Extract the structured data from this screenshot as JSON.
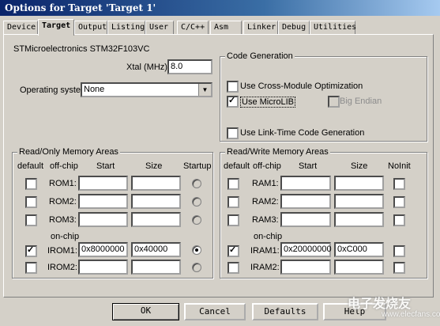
{
  "window": {
    "title": "Options for Target 'Target 1'"
  },
  "tabs": [
    "Device",
    "Target",
    "Output",
    "Listing",
    "User",
    "C/C++",
    "Asm",
    "Linker",
    "Debug",
    "Utilities"
  ],
  "device_name": "STMicroelectronics STM32F103VC",
  "xtal": {
    "label": "Xtal (MHz):",
    "value": "8.0"
  },
  "os": {
    "label": "Operating system:",
    "value": "None"
  },
  "code_generation": {
    "title": "Code Generation",
    "cross_module": {
      "label": "Use Cross-Module Optimization",
      "checked": false
    },
    "microlib": {
      "label": "Use MicroLIB",
      "checked": true
    },
    "big_endian": {
      "label": "Big Endian",
      "checked": false,
      "enabled": false
    },
    "link_time": {
      "label": "Use Link-Time Code Generation",
      "checked": false
    }
  },
  "rom_areas": {
    "title": "Read/Only Memory Areas",
    "headers": {
      "default": "default",
      "offchip": "off-chip",
      "start": "Start",
      "size": "Size",
      "startup": "Startup"
    },
    "onchip_label": "on-chip",
    "rows": [
      {
        "name": "ROM1:",
        "start": "",
        "size": "",
        "default": false,
        "startup": false
      },
      {
        "name": "ROM2:",
        "start": "",
        "size": "",
        "default": false,
        "startup": false
      },
      {
        "name": "ROM3:",
        "start": "",
        "size": "",
        "default": false,
        "startup": false
      },
      {
        "name": "IROM1:",
        "start": "0x8000000",
        "size": "0x40000",
        "default": true,
        "startup": true
      },
      {
        "name": "IROM2:",
        "start": "",
        "size": "",
        "default": false,
        "startup": false
      }
    ]
  },
  "ram_areas": {
    "title": "Read/Write Memory Areas",
    "headers": {
      "default": "default",
      "offchip": "off-chip",
      "start": "Start",
      "size": "Size",
      "noinit": "NoInit"
    },
    "onchip_label": "on-chip",
    "rows": [
      {
        "name": "RAM1:",
        "start": "",
        "size": "",
        "default": false,
        "noinit": false
      },
      {
        "name": "RAM2:",
        "start": "",
        "size": "",
        "default": false,
        "noinit": false
      },
      {
        "name": "RAM3:",
        "start": "",
        "size": "",
        "default": false,
        "noinit": false
      },
      {
        "name": "IRAM1:",
        "start": "0x20000000",
        "size": "0xC000",
        "default": true,
        "noinit": false
      },
      {
        "name": "IRAM2:",
        "start": "",
        "size": "",
        "default": false,
        "noinit": false
      }
    ]
  },
  "buttons": {
    "ok": "OK",
    "cancel": "Cancel",
    "defaults": "Defaults",
    "help": "Help"
  },
  "watermark": {
    "text": "电子发烧友",
    "url": "www.elecfans.com"
  }
}
